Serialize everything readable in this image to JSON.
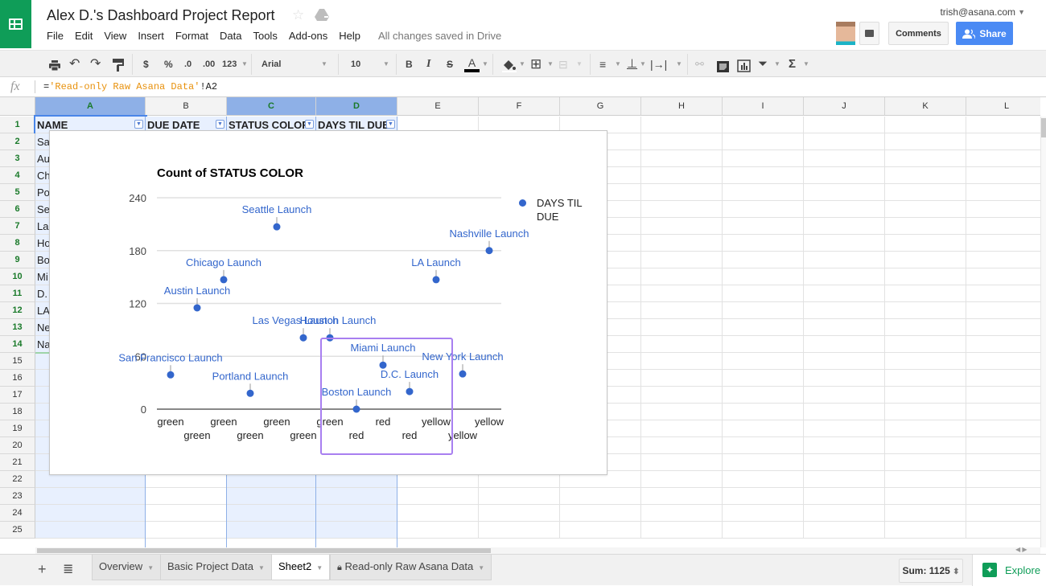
{
  "header": {
    "title": "Alex D.'s Dashboard Project Report",
    "menu": [
      "File",
      "Edit",
      "View",
      "Insert",
      "Format",
      "Data",
      "Tools",
      "Add-ons",
      "Help"
    ],
    "save_status": "All changes saved in Drive",
    "account": "trish@asana.com",
    "comments_label": "Comments",
    "share_label": "Share"
  },
  "toolbar": {
    "currency": "$",
    "percent": "%",
    "decrease_decimal": ".0",
    "increase_decimal": ".00",
    "more_formats": "123",
    "font": "Arial",
    "font_size": "10",
    "bold": "B",
    "italic": "I",
    "strikethrough": "S",
    "text_color": "A",
    "functions": "Σ"
  },
  "formula_bar": {
    "fx": "fx",
    "prefix": "=",
    "string": "'Read-only Raw Asana Data'",
    "suffix": "!A2"
  },
  "columns": [
    "A",
    "B",
    "C",
    "D",
    "E",
    "F",
    "G",
    "H",
    "I",
    "J",
    "K",
    "L"
  ],
  "selected_columns": [
    "A",
    "C",
    "D"
  ],
  "header_row": [
    "NAME",
    "DUE DATE",
    "STATUS COLOR",
    "DAYS TIL DUE"
  ],
  "column_a_visible": [
    "Sa",
    "Au",
    "Ch",
    "Po",
    "Se",
    "La",
    "Ho",
    "Bo",
    "Mi",
    "D.",
    "LA",
    "Ne",
    "Na"
  ],
  "rows": [
    "1",
    "2",
    "3",
    "4",
    "5",
    "6",
    "7",
    "8",
    "9",
    "10",
    "11",
    "12",
    "13",
    "14",
    "15",
    "16",
    "17",
    "18",
    "19",
    "20",
    "21",
    "22",
    "23",
    "24",
    "25"
  ],
  "chart_data": {
    "type": "scatter",
    "title": "Count of STATUS COLOR",
    "xlabel": "",
    "ylabel": "",
    "ylim": [
      0,
      240
    ],
    "yticks": [
      0,
      60,
      120,
      180,
      240
    ],
    "grid": true,
    "legend_position": "right",
    "series": [
      {
        "name": "DAYS TIL DUE",
        "color": "#3366cc",
        "points": [
          {
            "label": "San Francisco Launch",
            "category": "green",
            "y": 39
          },
          {
            "label": "Austin Launch",
            "category": "green",
            "y": 115
          },
          {
            "label": "Chicago Launch",
            "category": "green",
            "y": 147
          },
          {
            "label": "Portland Launch",
            "category": "green",
            "y": 18
          },
          {
            "label": "Seattle Launch",
            "category": "green",
            "y": 207
          },
          {
            "label": "Las Vegas Launch",
            "category": "green",
            "y": 81
          },
          {
            "label": "Houston Launch",
            "category": "green",
            "y": 81
          },
          {
            "label": "Boston Launch",
            "category": "red",
            "y": 0
          },
          {
            "label": "Miami Launch",
            "category": "red",
            "y": 50
          },
          {
            "label": "D.C. Launch",
            "category": "red",
            "y": 20
          },
          {
            "label": "LA Launch",
            "category": "yellow",
            "y": 147
          },
          {
            "label": "New York Launch",
            "category": "yellow",
            "y": 40
          },
          {
            "label": "Nashville Launch",
            "category": "yellow",
            "y": 180
          }
        ]
      }
    ],
    "categories": [
      "green",
      "green",
      "green",
      "green",
      "green",
      "green",
      "green",
      "red",
      "red",
      "red",
      "yellow",
      "yellow",
      "yellow"
    ]
  },
  "sheet_tabs": [
    {
      "label": "Overview",
      "active": false,
      "locked": false
    },
    {
      "label": "Basic Project Data",
      "active": false,
      "locked": false
    },
    {
      "label": "Sheet2",
      "active": true,
      "locked": false
    },
    {
      "label": "Read-only Raw Asana Data",
      "active": false,
      "locked": true
    }
  ],
  "status": {
    "sum": "Sum: 1125",
    "explore_label": "Explore"
  },
  "colors": {
    "brand_green": "#0f9d58",
    "share_blue": "#4a8af4",
    "series_blue": "#3366cc",
    "selection_purple": "#a87ff0",
    "formula_string": "#e8910c"
  }
}
